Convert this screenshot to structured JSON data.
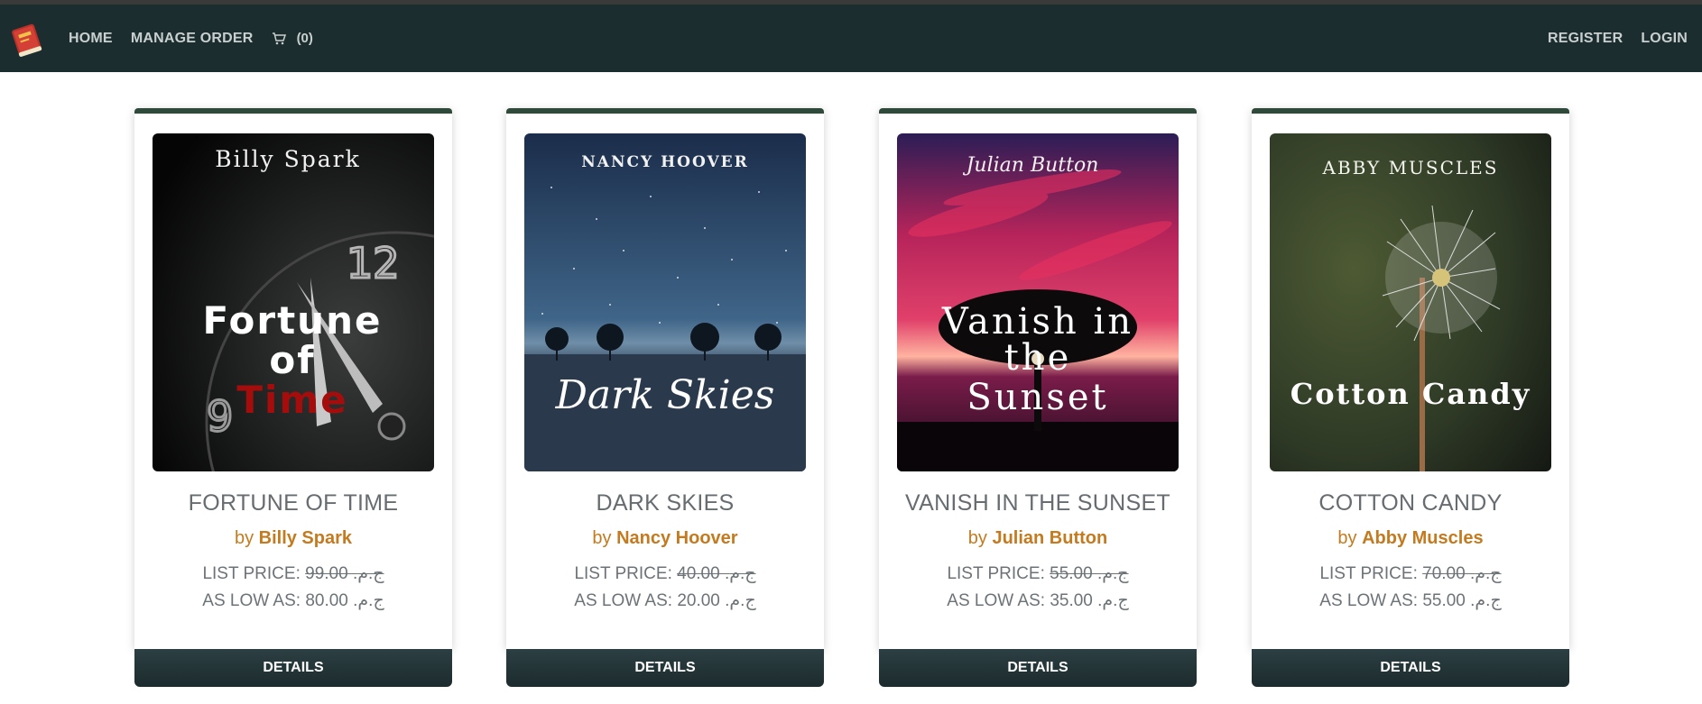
{
  "nav": {
    "home": "HOME",
    "manage_order": "MANAGE ORDER",
    "cart_count": "(0)",
    "register": "REGISTER",
    "login": "LOGIN"
  },
  "books": [
    {
      "cover_author": "Billy Spark",
      "cover_title_1": "Fortune",
      "cover_title_2": "of",
      "cover_title_3": "Time",
      "title": "FORTUNE OF TIME",
      "by": "by",
      "author": "Billy Spark",
      "list_price_label": "LIST PRICE:",
      "list_price": "99.00 .ج.م",
      "low_label": "AS LOW AS:",
      "low_price": "80.00 .ج.م",
      "details": "DETAILS"
    },
    {
      "cover_author": "NANCY HOOVER",
      "cover_title_1": "Dark Skies",
      "title": "DARK SKIES",
      "by": "by",
      "author": "Nancy Hoover",
      "list_price_label": "LIST PRICE:",
      "list_price": "40.00 .ج.م",
      "low_label": "AS LOW AS:",
      "low_price": "20.00 .ج.م",
      "details": "DETAILS"
    },
    {
      "cover_author": "Julian Button",
      "cover_title_1": "Vanish in",
      "cover_title_2": "the",
      "cover_title_3": "Sunset",
      "title": "VANISH IN THE SUNSET",
      "by": "by",
      "author": "Julian Button",
      "list_price_label": "LIST PRICE:",
      "list_price": "55.00 .ج.م",
      "low_label": "AS LOW AS:",
      "low_price": "35.00 .ج.م",
      "details": "DETAILS"
    },
    {
      "cover_author": "ABBY MUSCLES",
      "cover_title_1": "Cotton Candy",
      "title": "COTTON CANDY",
      "by": "by",
      "author": "Abby Muscles",
      "list_price_label": "LIST PRICE:",
      "list_price": "70.00 .ج.م",
      "low_label": "AS LOW AS:",
      "low_price": "55.00 .ج.م",
      "details": "DETAILS"
    }
  ],
  "icons": {
    "logo": "book-logo-icon",
    "cart": "cart-icon"
  },
  "colors": {
    "navbar": "#1b2d2f",
    "accent_author": "#c47a1e",
    "card_top_border": "#2f4a3a",
    "button": "#1c2b2e"
  }
}
